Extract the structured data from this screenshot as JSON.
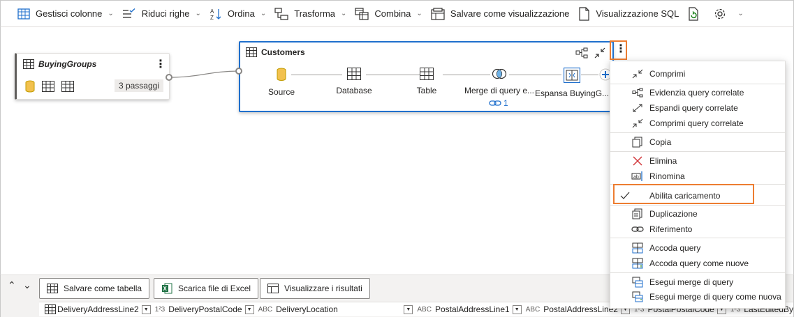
{
  "toolbar": {
    "items": [
      {
        "label": "Gestisci colonne",
        "icon": "table-columns-icon",
        "has_dropdown": true
      },
      {
        "label": "Riduci righe",
        "icon": "reduce-rows-icon",
        "has_dropdown": true
      },
      {
        "label": "Ordina",
        "icon": "sort-az-icon",
        "has_dropdown": true
      },
      {
        "label": "Trasforma",
        "icon": "transform-icon",
        "has_dropdown": true
      },
      {
        "label": "Combina",
        "icon": "combine-icon",
        "has_dropdown": true
      },
      {
        "label": "Salvare come visualizzazione",
        "icon": "save-view-icon",
        "has_dropdown": false
      },
      {
        "label": "Visualizzazione SQL",
        "icon": "sql-view-icon",
        "has_dropdown": false
      },
      {
        "label": "",
        "icon": "refresh-icon",
        "has_dropdown": false
      },
      {
        "label": "",
        "icon": "gear-icon",
        "has_dropdown": true
      }
    ]
  },
  "diagram": {
    "buying_groups": {
      "title": "BuyingGroups",
      "steps_badge": "3 passaggi",
      "icons": [
        "database-icon",
        "table-icon",
        "table-icon"
      ]
    },
    "customers": {
      "title": "Customers",
      "steps": [
        {
          "label": "Source",
          "icon": "database-icon"
        },
        {
          "label": "Database",
          "icon": "table-icon"
        },
        {
          "label": "Table",
          "icon": "table-icon"
        },
        {
          "label": "Merge di query e...",
          "icon": "merge-icon"
        },
        {
          "label": "Espansa BuyingG...",
          "icon": "expand-icon"
        }
      ],
      "link_count": "1"
    }
  },
  "context_menu": {
    "items": [
      {
        "label": "Comprimi",
        "icon": "collapse-icon",
        "checked": false
      },
      {
        "label": "Evidenzia query correlate",
        "icon": "highlight-related-icon",
        "checked": false
      },
      {
        "label": "Espandi query correlate",
        "icon": "expand-related-icon",
        "checked": false
      },
      {
        "label": "Comprimi query correlate",
        "icon": "collapse-related-icon",
        "checked": false
      },
      {
        "label": "Copia",
        "icon": "copy-icon",
        "checked": false
      },
      {
        "label": "Elimina",
        "icon": "delete-icon",
        "checked": false
      },
      {
        "label": "Rinomina",
        "icon": "rename-icon",
        "checked": false
      },
      {
        "label": "Abilita caricamento",
        "icon": "checkmark-icon",
        "checked": true
      },
      {
        "label": "Duplicazione",
        "icon": "duplicate-icon",
        "checked": false
      },
      {
        "label": "Riferimento",
        "icon": "reference-icon",
        "checked": false
      },
      {
        "label": "Accoda query",
        "icon": "append-query-icon",
        "checked": false
      },
      {
        "label": "Accoda query come nuove",
        "icon": "append-new-icon",
        "checked": false
      },
      {
        "label": "Esegui merge di query",
        "icon": "merge-query-icon",
        "checked": false
      },
      {
        "label": "Esegui merge di query come nuova",
        "icon": "merge-new-icon",
        "checked": false
      }
    ]
  },
  "bottom": {
    "buttons": [
      {
        "label": "Salvare come tabella",
        "icon": "table-icon"
      },
      {
        "label": "Scarica file di Excel",
        "icon": "excel-icon"
      },
      {
        "label": "Visualizzare i risultati",
        "icon": "results-icon"
      }
    ],
    "columns": [
      {
        "type": "",
        "name": "DeliveryAddressLine2"
      },
      {
        "type": "1²3",
        "name": "DeliveryPostalCode"
      },
      {
        "type": "ABC",
        "name": "DeliveryLocation"
      },
      {
        "type": "ABC",
        "name": "PostalAddressLine1"
      },
      {
        "type": "ABC",
        "name": "PostalAddressLine2"
      },
      {
        "type": "1²3",
        "name": "PostalPostalCode"
      },
      {
        "type": "1²3",
        "name": "LastEditedBy"
      }
    ]
  },
  "colors": {
    "accent": "#1f6fcc",
    "highlight": "#ed7d31",
    "excel": "#217346"
  }
}
